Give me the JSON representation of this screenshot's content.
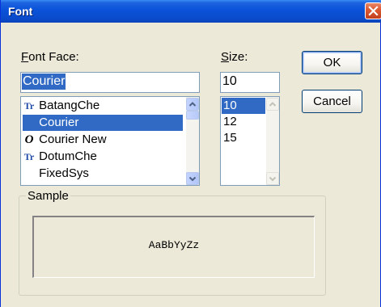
{
  "window": {
    "title": "Font"
  },
  "font_face": {
    "label_accel": "F",
    "label_rest": "ont Face:",
    "value": "Courier",
    "options": [
      {
        "icon": "truetype-icon",
        "glyph": "Tr",
        "label": "BatangChe",
        "selected": false
      },
      {
        "icon": "",
        "glyph": "",
        "label": "Courier",
        "selected": true
      },
      {
        "icon": "opentype-icon",
        "glyph": "O",
        "label": "Courier New",
        "selected": false
      },
      {
        "icon": "truetype-icon",
        "glyph": "Tr",
        "label": "DotumChe",
        "selected": false
      },
      {
        "icon": "",
        "glyph": "",
        "label": "FixedSys",
        "selected": false
      }
    ]
  },
  "size": {
    "label_accel": "S",
    "label_rest": "ize:",
    "value": "10",
    "options": [
      {
        "label": "10",
        "selected": true
      },
      {
        "label": "12",
        "selected": false
      },
      {
        "label": "15",
        "selected": false
      }
    ]
  },
  "buttons": {
    "ok": "OK",
    "cancel": "Cancel"
  },
  "sample": {
    "label": "Sample",
    "text": "AaBbYyZz"
  },
  "colors": {
    "selection": "#316ac5",
    "titlebar": "#0a52d8",
    "face": "#ece9d8"
  }
}
